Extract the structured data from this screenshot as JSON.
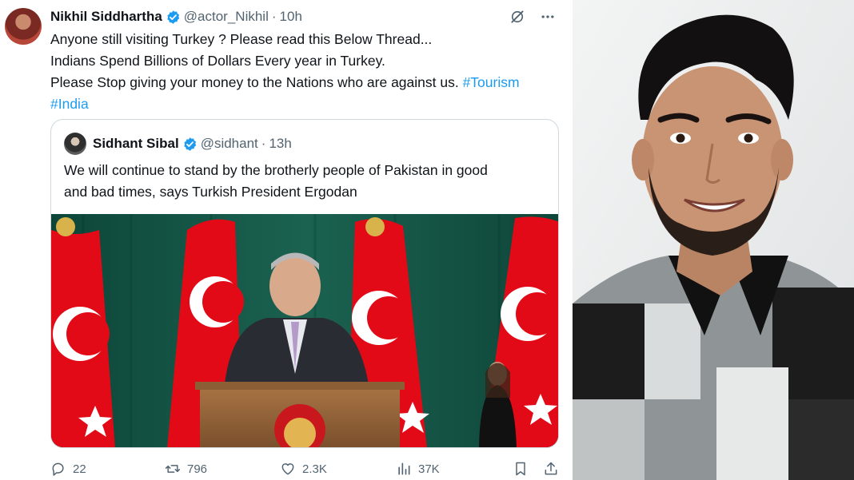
{
  "tweet": {
    "author_name": "Nikhil Siddhartha",
    "handle": "@actor_Nikhil",
    "separator": "·",
    "time": "10h",
    "lines": [
      "Anyone still visiting Turkey ? Please read this Below Thread...",
      "Indians Spend Billions of Dollars Every year in Turkey.",
      "Please Stop giving your money to the Nations who are against us. "
    ],
    "hashtag_1": "#Tourism",
    "hashtag_2": "#India"
  },
  "quote": {
    "author_name": "Sidhant Sibal",
    "handle": "@sidhant",
    "separator": "·",
    "time": "13h",
    "lines": [
      "We will continue to stand by the brotherly people of Pakistan in good",
      "and bad times, says Turkish President Ergodan"
    ]
  },
  "actions": {
    "replies": "22",
    "reposts": "796",
    "likes": "2.3K",
    "views": "37K"
  },
  "icons": {
    "verified": "verified-badge-icon",
    "grok": "grok-icon",
    "more": "more-icon",
    "reply": "reply-icon",
    "repost": "repost-icon",
    "like": "heart-icon",
    "views": "views-icon",
    "bookmark": "bookmark-icon",
    "share": "share-icon"
  },
  "colors": {
    "link": "#1d9bf0",
    "secondary_text": "#536471",
    "verified": "#1d9bf0",
    "flag_red": "#e30a17"
  }
}
